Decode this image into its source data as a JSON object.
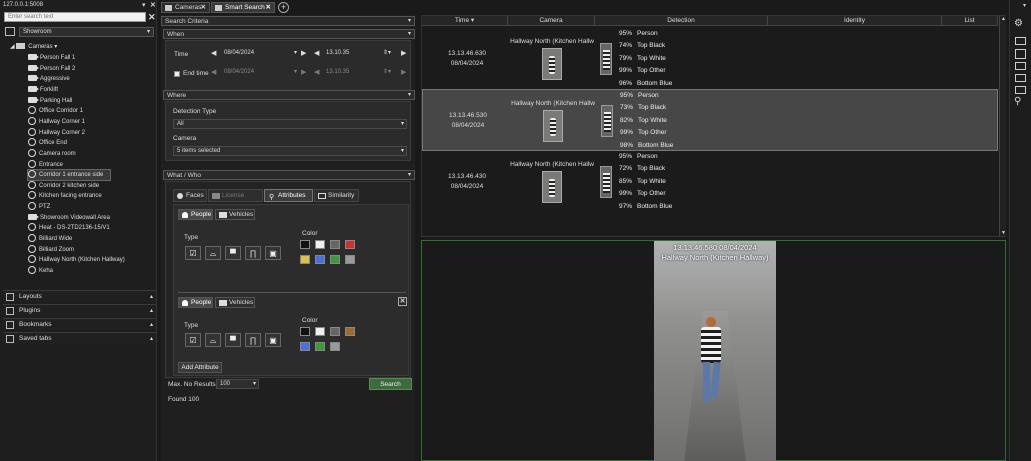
{
  "app": {
    "address": "127.0.0.1:5008"
  },
  "tabs": [
    {
      "label": "Cameras",
      "active": false
    },
    {
      "label": "Smart Search",
      "active": true
    }
  ],
  "left": {
    "search_placeholder": "Enter search text",
    "site": "Showroom",
    "group": "Cameras",
    "cameras": [
      "Person Fall 1",
      "Person Fall 2",
      "Aggressive",
      "Forklift",
      "Parking Hall",
      "Office Corridor 1",
      "Hallway Corner 1",
      "Hallway Corner 2",
      "Office End",
      "Camera room",
      "Entrance",
      "Corridor 1 entrance side",
      "Corridor 2 kitchen side",
      "Kitchen facing entrance",
      "PTZ",
      "Showroom Videowall Area",
      "Heat - DS-2TD2136-15/V1",
      "Billiard Wide",
      "Billiard Zoom",
      "Hallway North (Kitchen Hallway)",
      "Keha"
    ],
    "selected_camera": "Corridor 1 entrance side",
    "accordions": [
      "Layouts",
      "Plugins",
      "Bookmarks",
      "Saved tabs"
    ]
  },
  "criteria": {
    "header": "Search Criteria",
    "when": {
      "title": "When",
      "time_label": "Time",
      "date": "08/04/2024",
      "time": "13.10.35",
      "end_label": "End time",
      "end_date": "08/04/2024",
      "end_time": "13.10.35"
    },
    "where": {
      "title": "Where",
      "detection_type_label": "Detection Type",
      "detection_type": "All",
      "camera_label": "Camera",
      "camera": "5 items selected"
    },
    "what": {
      "title": "What / Who",
      "tabs": [
        "Faces",
        "License plates",
        "Attributes",
        "Similarity"
      ],
      "active_tab": "Attributes",
      "block1": {
        "people": "People",
        "vehicles": "Vehicles",
        "type_label": "Type",
        "color_label": "Color"
      },
      "block2": {
        "people": "People",
        "vehicles": "Vehicles",
        "type_label": "Type",
        "color_label": "Color"
      },
      "add_attribute": "Add Attribute"
    },
    "max_label": "Max. No Results",
    "max_value": "100",
    "search_button": "Search",
    "found": "Found 100"
  },
  "results": {
    "columns": [
      "Time",
      "Camera",
      "Detection",
      "Identity",
      "List"
    ],
    "rows": [
      {
        "time": "13.13.46.630",
        "date": "08/04/2024",
        "camera": "Hallway North (Kitchen Hallw",
        "attrs": [
          {
            "pct": "95%",
            "label": "Person"
          },
          {
            "pct": "74%",
            "label": "Top Black"
          },
          {
            "pct": "79%",
            "label": "Top White"
          },
          {
            "pct": "99%",
            "label": "Top Other"
          },
          {
            "pct": "96%",
            "label": "Bottom Blue"
          }
        ]
      },
      {
        "time": "13.13.46.530",
        "date": "08/04/2024",
        "camera": "Hallway North (Kitchen Hallw",
        "attrs": [
          {
            "pct": "95%",
            "label": "Person"
          },
          {
            "pct": "73%",
            "label": "Top Black"
          },
          {
            "pct": "82%",
            "label": "Top White"
          },
          {
            "pct": "99%",
            "label": "Top Other"
          },
          {
            "pct": "98%",
            "label": "Bottom Blue"
          }
        ]
      },
      {
        "time": "13.13.46.430",
        "date": "08/04/2024",
        "camera": "Hallway North (Kitchen Hallw",
        "attrs": [
          {
            "pct": "95%",
            "label": "Person"
          },
          {
            "pct": "72%",
            "label": "Top Black"
          },
          {
            "pct": "85%",
            "label": "Top White"
          },
          {
            "pct": "99%",
            "label": "Top Other"
          },
          {
            "pct": "97%",
            "label": "Bottom Blue"
          }
        ]
      }
    ]
  },
  "video": {
    "timestamp": "13.13.46.580 08/04/2024",
    "camera": "Hallway North (Kitchen Hallway)"
  },
  "colors": {
    "block1": [
      "#111111",
      "#f0f0f0",
      "#666666",
      "#d03030",
      "#e0c040",
      "#4a70e0",
      "#3a9a3a",
      "#9a9a9a"
    ],
    "block2": [
      "#111111",
      "#f0f0f0",
      "#666666",
      "#a06a2a",
      "#4a70e0",
      "#3a9a3a",
      "#9a9a9a"
    ],
    "accent": "#3d6a3d",
    "selected_row": "#474747"
  }
}
